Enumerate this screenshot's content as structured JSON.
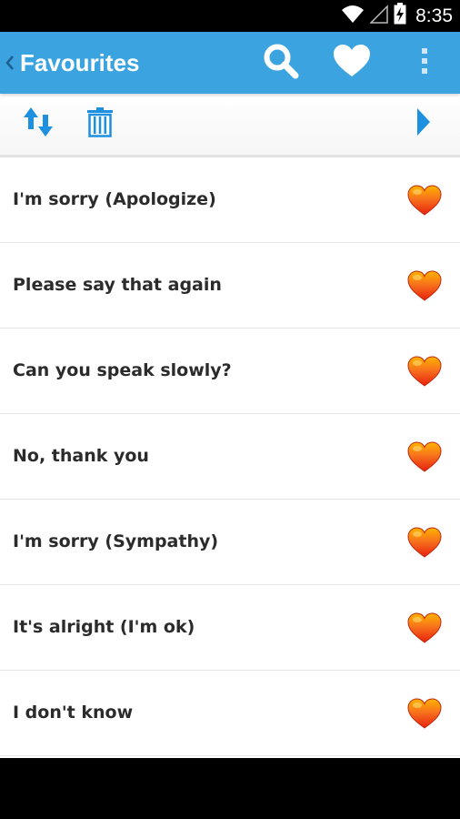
{
  "status_bar": {
    "time": "8:35"
  },
  "action_bar": {
    "title": "Favourites",
    "background_color": "#3ba3df",
    "icons": [
      "chevron-left-icon",
      "search-icon",
      "heart-icon",
      "overflow-menu-icon"
    ]
  },
  "toolbar": {
    "icons": [
      "sort-icon",
      "trash-icon",
      "play-next-icon"
    ],
    "accent_color": "#1e90e0"
  },
  "favourites": [
    {
      "label": "I'm sorry (Apologize)"
    },
    {
      "label": "Please say that again"
    },
    {
      "label": "Can you speak slowly?"
    },
    {
      "label": "No, thank you"
    },
    {
      "label": "I'm sorry (Sympathy)"
    },
    {
      "label": "It's alright (I'm ok)"
    },
    {
      "label": "I don't know"
    }
  ],
  "favourite_heart_color": "#f2521e"
}
